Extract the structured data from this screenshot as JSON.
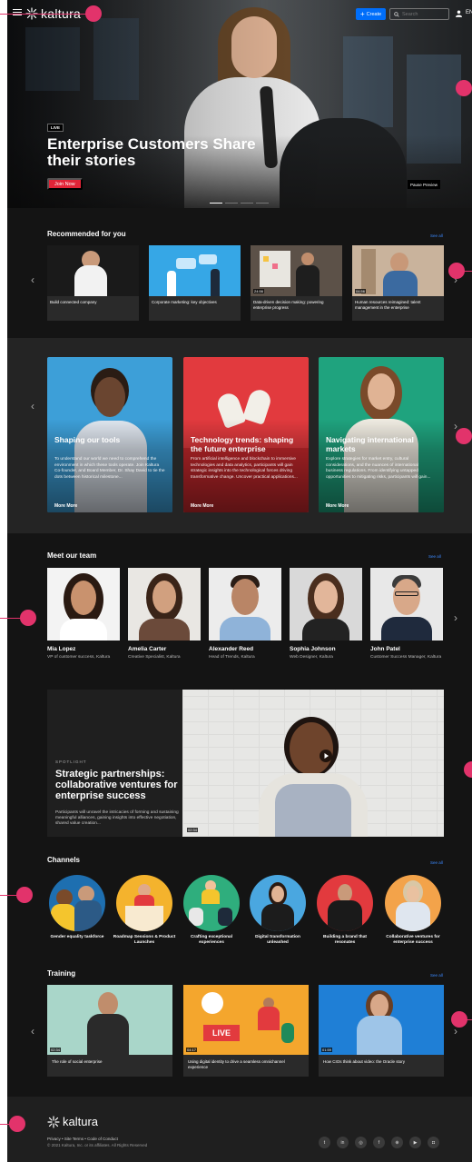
{
  "header": {
    "logo_text": "kaltura",
    "create_label": "Create",
    "search_placeholder": "Search",
    "lang": "EN"
  },
  "hero": {
    "badge": "LIVE",
    "title": "Enterprise Customers Share their stories",
    "join_label": "Join Now",
    "pause_label": "Pause Preview"
  },
  "recommended": {
    "title": "Recommended for you",
    "see_all": "See all",
    "items": [
      {
        "caption": "Build connected company",
        "duration": ""
      },
      {
        "caption": "Corporate marketing: key objectives",
        "duration": ""
      },
      {
        "caption": "Data-driven decision making: powering enterprise progress",
        "duration": "24:56"
      },
      {
        "caption": "Human resources reimagined: talent management in the enterprise",
        "duration": "04:56"
      }
    ]
  },
  "featured": {
    "items": [
      {
        "title": "Shaping our tools",
        "desc": "To understand our world we need to comprehend the environment in which these tools operate. Join Kaltura Co-founder, and Board Member, Dr. Shay David to tie the dots between historical milestone...",
        "more": "More More",
        "color": "#3d9fd8"
      },
      {
        "title": "Technology trends: shaping the future enterprise",
        "desc": "From artificial intelligence and blockchain to immersive technologies and data analytics, participants will gain strategic insights into the technological forces driving transformative change. Uncover practical applications...",
        "more": "More More",
        "color": "#e23a3e"
      },
      {
        "title": "Navigating international markets",
        "desc": "Explore strategies for market entry, cultural considerations, and the nuances of international business regulations. From identifying untapped opportunities to mitigating risks, participants will gain...",
        "more": "More More",
        "color": "#1fa37e"
      }
    ]
  },
  "team": {
    "title": "Meet our team",
    "see_all": "See all",
    "members": [
      {
        "name": "Mia Lopez",
        "role": "VP of customer success, Kaltura"
      },
      {
        "name": "Amelia Carter",
        "role": "Creative Specialist, Kaltura"
      },
      {
        "name": "Alexander Reed",
        "role": "Head of Trends, Kaltura"
      },
      {
        "name": "Sophia Johnson",
        "role": "Web Designer, Kaltura"
      },
      {
        "name": "John Patel",
        "role": "Customer Success Manager, Kaltura"
      }
    ]
  },
  "spotlight": {
    "label": "SPOTLIGHT",
    "title": "Strategic partnerships: collaborative ventures for enterprise success",
    "desc": "Participants will unravel the intricacies of forming and sustaining meaningful alliances, gaining insights into effective negotiation, shared value creation...",
    "duration": "02:34"
  },
  "channels": {
    "title": "Channels",
    "see_all": "See all",
    "items": [
      {
        "label": "Gender equality taskforce",
        "color": "#1e6fb0"
      },
      {
        "label": "Roadmap Sessions & Product Launches",
        "color": "#f4b32d"
      },
      {
        "label": "Crafting exceptional experiences",
        "color": "#2fae7d"
      },
      {
        "label": "Digital transformation unleashed",
        "color": "#4aa7e0"
      },
      {
        "label": "Building a brand that resonates",
        "color": "#e23a3e"
      },
      {
        "label": "Collaborative ventures for enterprise success",
        "color": "#f3a34a"
      }
    ]
  },
  "training": {
    "title": "Training",
    "see_all": "See all",
    "items": [
      {
        "caption": "The role of social enterprise",
        "duration": "02:34"
      },
      {
        "caption": "Using digital identity to drive a seamless omnichannel experience",
        "duration": "04:17"
      },
      {
        "caption": "How CIOs think about video: the Oracle story",
        "duration": "01:59"
      }
    ]
  },
  "footer": {
    "logo_text": "kaltura",
    "links": "Privacy  •  Site Terms  •  Code of Conduct",
    "copyright": "© 2021 Kaltura, Inc. or its affiliates. All Rights Reserved",
    "socials": [
      "twitter-icon",
      "linkedin-icon",
      "instagram-icon",
      "facebook-icon",
      "web-icon",
      "youtube-icon",
      "twitch-icon"
    ]
  }
}
